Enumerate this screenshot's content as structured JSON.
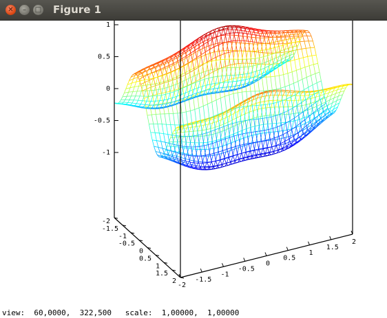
{
  "window": {
    "title": "Figure 1"
  },
  "icons": {
    "close": "close-icon",
    "minimize": "minimize-icon",
    "maximize": "maximize-icon"
  },
  "chart_data": {
    "type": "surface-mesh",
    "z_ticks": [
      "1",
      "0.5",
      "0",
      "-0.5",
      "-1"
    ],
    "left_axis_ticks": [
      "-2",
      "-1.5",
      "-1",
      "-0.5",
      "0",
      "0.5",
      "1",
      "1.5",
      "2"
    ],
    "right_axis_ticks": [
      "-2",
      "-1.5",
      "-1",
      "-0.5",
      "0",
      "0.5",
      "1",
      "1.5",
      "2"
    ],
    "zlim": [
      -1,
      1
    ],
    "colormap": "jet",
    "view": {
      "azimuth": 60.0,
      "elevation": 322.5
    },
    "scale": [
      1.0,
      1.0
    ]
  },
  "status": {
    "text": "view:  60,0000,  322,500   scale:  1,00000,  1,00000"
  }
}
